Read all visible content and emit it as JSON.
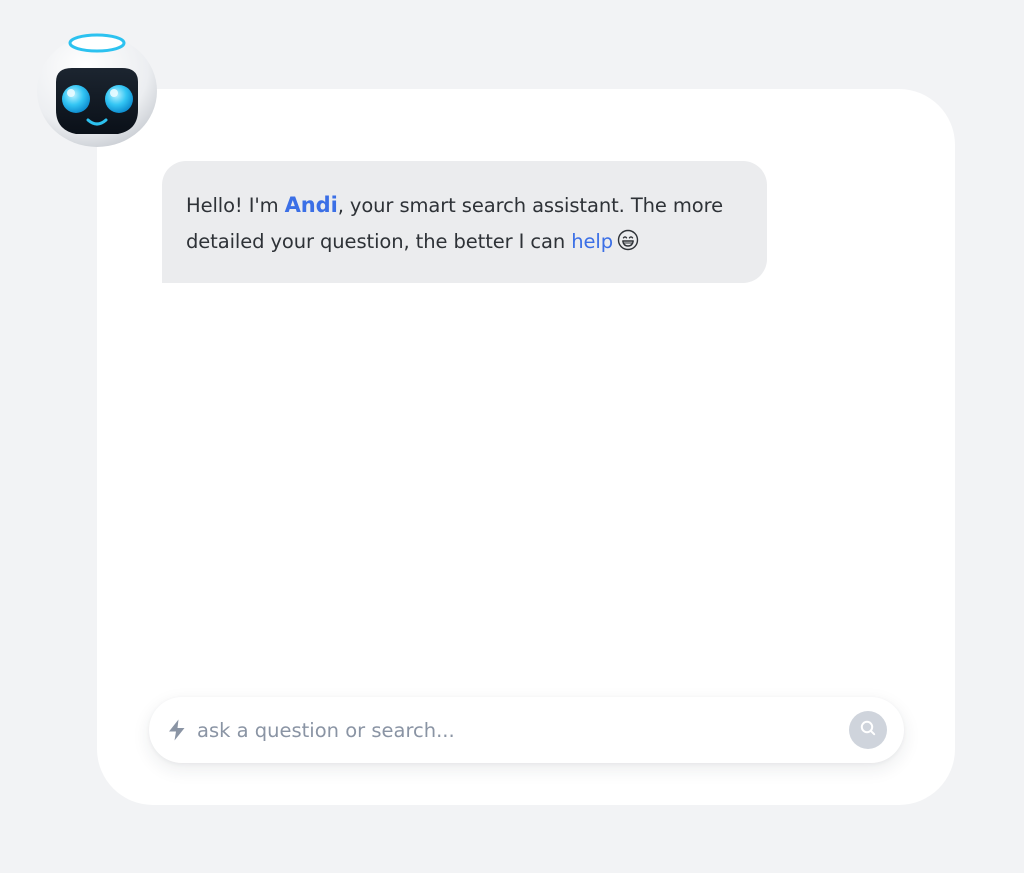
{
  "assistant": {
    "avatar_icon": "robot-avatar-icon"
  },
  "message": {
    "text_before": "Hello! I'm ",
    "name": "Andi",
    "text_middle": ", your smart search assistant. The more detailed your question, the better I can ",
    "link_text": "help",
    "emoji_icon": "grinning-face-icon"
  },
  "search": {
    "placeholder": "ask a question or search...",
    "value": "",
    "left_icon": "lightning-bolt-icon",
    "button_icon": "search-icon"
  },
  "colors": {
    "background": "#f2f3f5",
    "card": "#ffffff",
    "bubble": "#ebecee",
    "accent": "#3b6fe6",
    "placeholder": "#8a94a4",
    "search_button": "#cfd4dc"
  }
}
